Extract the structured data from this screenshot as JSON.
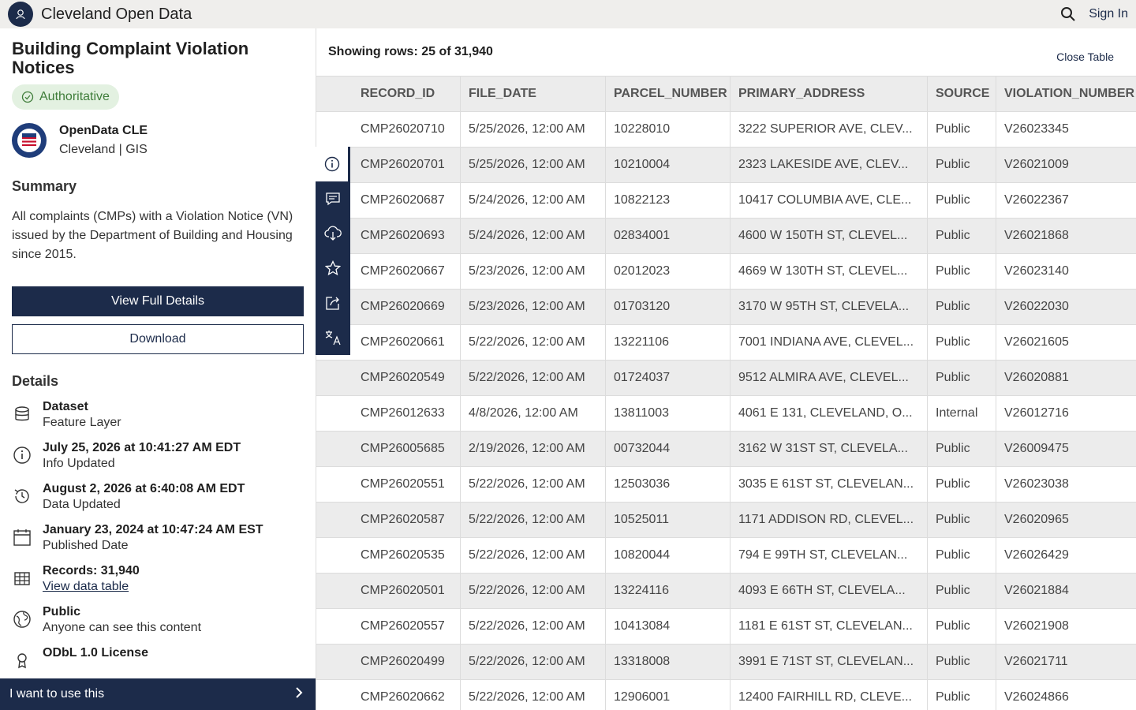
{
  "header": {
    "site_title": "Cleveland Open Data",
    "sign_in": "Sign In"
  },
  "dataset": {
    "title": "Building Complaint Violation Notices",
    "badge": "Authoritative",
    "owner_name": "OpenData CLE",
    "owner_org": "Cleveland | GIS",
    "summary_heading": "Summary",
    "summary": "All complaints (CMPs) with a Violation Notice (VN) issued by the Department of Building and Housing since 2015.",
    "view_full_details": "View Full Details",
    "download": "Download",
    "details_heading": "Details",
    "use_this": "I want to use this"
  },
  "details": [
    {
      "icon": "database-icon",
      "main": "Dataset",
      "sub": "Feature Layer"
    },
    {
      "icon": "info-icon",
      "main": "July 25, 2026 at 10:41:27 AM EDT",
      "sub": "Info Updated"
    },
    {
      "icon": "history-icon",
      "main": "August 2, 2026 at 6:40:08 AM EDT",
      "sub": "Data Updated"
    },
    {
      "icon": "calendar-icon",
      "main": "January 23, 2024 at 10:47:24 AM EST",
      "sub": "Published Date"
    },
    {
      "icon": "table-icon",
      "main": "Records: 31,940",
      "link": "View data table"
    },
    {
      "icon": "globe-icon",
      "main": "Public",
      "sub": "Anyone can see this content"
    },
    {
      "icon": "license-icon",
      "main": "ODbL 1.0 License"
    }
  ],
  "table": {
    "rows_info": "Showing rows: 25 of 31,940",
    "close": "Close Table",
    "columns": [
      "RECORD_ID",
      "FILE_DATE",
      "PARCEL_NUMBER",
      "PRIMARY_ADDRESS",
      "SOURCE",
      "VIOLATION_NUMBER"
    ],
    "rows": [
      [
        "CMP26020710",
        "5/25/2026, 12:00 AM",
        "10228010",
        "3222 SUPERIOR AVE, CLEV...",
        "Public",
        "V26023345"
      ],
      [
        "CMP26020701",
        "5/25/2026, 12:00 AM",
        "10210004",
        "2323 LAKESIDE AVE, CLEV...",
        "Public",
        "V26021009"
      ],
      [
        "CMP26020687",
        "5/24/2026, 12:00 AM",
        "10822123",
        "10417 COLUMBIA AVE, CLE...",
        "Public",
        "V26022367"
      ],
      [
        "CMP26020693",
        "5/24/2026, 12:00 AM",
        "02834001",
        "4600 W 150TH ST, CLEVEL...",
        "Public",
        "V26021868"
      ],
      [
        "CMP26020667",
        "5/23/2026, 12:00 AM",
        "02012023",
        "4669 W 130TH ST, CLEVEL...",
        "Public",
        "V26023140"
      ],
      [
        "CMP26020669",
        "5/23/2026, 12:00 AM",
        "01703120",
        "3170 W 95TH ST, CLEVELA...",
        "Public",
        "V26022030"
      ],
      [
        "CMP26020661",
        "5/22/2026, 12:00 AM",
        "13221106",
        "7001 INDIANA AVE, CLEVEL...",
        "Public",
        "V26021605"
      ],
      [
        "CMP26020549",
        "5/22/2026, 12:00 AM",
        "01724037",
        "9512 ALMIRA AVE, CLEVEL...",
        "Public",
        "V26020881"
      ],
      [
        "CMP26012633",
        "4/8/2026, 12:00 AM",
        "13811003",
        "4061 E 131, CLEVELAND, O...",
        "Internal",
        "V26012716"
      ],
      [
        "CMP26005685",
        "2/19/2026, 12:00 AM",
        "00732044",
        "3162 W 31ST ST, CLEVELA...",
        "Public",
        "V26009475"
      ],
      [
        "CMP26020551",
        "5/22/2026, 12:00 AM",
        "12503036",
        "3035 E 61ST ST, CLEVELAN...",
        "Public",
        "V26023038"
      ],
      [
        "CMP26020587",
        "5/22/2026, 12:00 AM",
        "10525011",
        "1171 ADDISON RD, CLEVEL...",
        "Public",
        "V26020965"
      ],
      [
        "CMP26020535",
        "5/22/2026, 12:00 AM",
        "10820044",
        "794 E 99TH ST, CLEVELAN...",
        "Public",
        "V26026429"
      ],
      [
        "CMP26020501",
        "5/22/2026, 12:00 AM",
        "13224116",
        "4093 E 66TH ST, CLEVELA...",
        "Public",
        "V26021884"
      ],
      [
        "CMP26020557",
        "5/22/2026, 12:00 AM",
        "10413084",
        "1181 E 61ST ST, CLEVELAN...",
        "Public",
        "V26021908"
      ],
      [
        "CMP26020499",
        "5/22/2026, 12:00 AM",
        "13318008",
        "3991 E 71ST ST, CLEVELAN...",
        "Public",
        "V26021711"
      ],
      [
        "CMP26020662",
        "5/22/2026, 12:00 AM",
        "12906001",
        "12400 FAIRHILL RD, CLEVE...",
        "Public",
        "V26024866"
      ]
    ]
  },
  "rail": [
    "info-icon",
    "comment-icon",
    "cloud-download-icon",
    "star-icon",
    "share-icon",
    "translate-icon"
  ],
  "colors": {
    "brand": "#1c2b4a",
    "badge_bg": "#e3f1e1",
    "badge_text": "#3f7d3a"
  }
}
